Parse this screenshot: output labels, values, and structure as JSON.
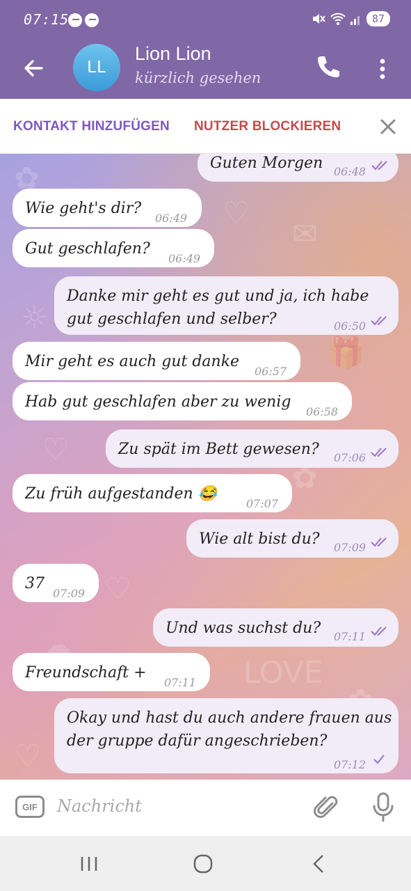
{
  "status_bar": {
    "time": "07:15",
    "battery": "87",
    "icons": [
      "messenger-icon",
      "messenger-icon",
      "mute-icon",
      "wifi-icon",
      "signal-icon"
    ]
  },
  "header": {
    "avatar_initials": "LL",
    "contact_name": "Lion Lion",
    "contact_status": "kürzlich gesehen",
    "colors": {
      "header_bg": "#8067a6",
      "avatar": "#4aa7e0"
    }
  },
  "action_bar": {
    "add_contact": "KONTAKT HINZUFÜGEN",
    "block_user": "NUTZER BLOCKIEREN"
  },
  "messages": [
    {
      "dir": "out",
      "text": "Guten Morgen",
      "time": "06:48",
      "status": "read"
    },
    {
      "dir": "in",
      "text": "Wie geht's dir?",
      "time": "06:49"
    },
    {
      "dir": "in",
      "text": "Gut geschlafen?",
      "time": "06:49"
    },
    {
      "dir": "out",
      "text": "Danke mir geht es gut und ja, ich habe gut geschlafen und selber?",
      "time": "06:50",
      "status": "read"
    },
    {
      "dir": "in",
      "text": "Mir geht es auch gut danke",
      "time": "06:57"
    },
    {
      "dir": "in",
      "text": "Hab gut geschlafen aber zu wenig",
      "time": "06:58"
    },
    {
      "dir": "out",
      "text": "Zu spät im Bett gewesen?",
      "time": "07:06",
      "status": "read"
    },
    {
      "dir": "in",
      "text": "Zu früh aufgestanden 😂",
      "time": "07:07"
    },
    {
      "dir": "out",
      "text": "Wie alt bist du?",
      "time": "07:09",
      "status": "read"
    },
    {
      "dir": "in",
      "text": "37",
      "time": "07:09"
    },
    {
      "dir": "out",
      "text": "Und was suchst du?",
      "time": "07:11",
      "status": "read"
    },
    {
      "dir": "in",
      "text": "Freundschaft +",
      "time": "07:11"
    },
    {
      "dir": "out",
      "text": "Okay und hast du auch andere frauen aus der gruppe dafür angeschrieben?",
      "time": "07:12",
      "status": "sent"
    }
  ],
  "input_bar": {
    "gif_label": "GIF",
    "placeholder": "Nachricht"
  }
}
